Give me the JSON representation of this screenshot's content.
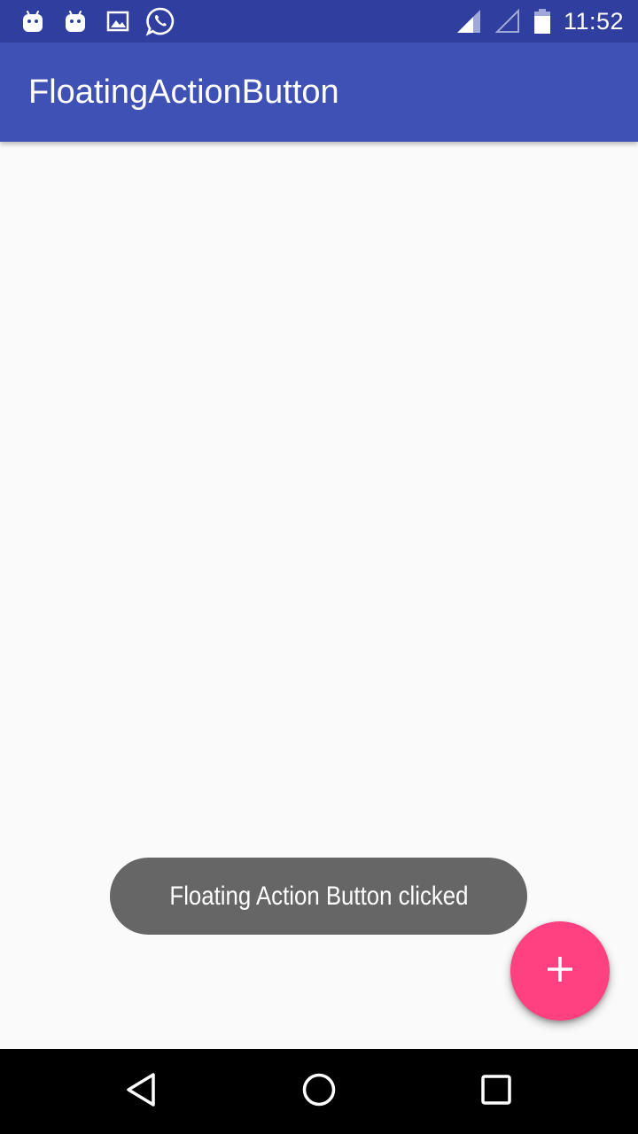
{
  "status_bar": {
    "time": "11:52",
    "left_icons": [
      "android-icon",
      "android-icon",
      "image-icon",
      "whatsapp-icon"
    ],
    "right_icons": [
      "signal-icon",
      "signal-empty-icon",
      "battery-icon"
    ]
  },
  "app_bar": {
    "title": "FloatingActionButton"
  },
  "toast": {
    "message": "Floating Action Button clicked"
  },
  "fab": {
    "icon": "plus-icon",
    "color": "#ff4081"
  },
  "nav_bar": {
    "buttons": [
      "back-icon",
      "home-icon",
      "recents-icon"
    ]
  },
  "colors": {
    "status_bar": "#303f9f",
    "app_bar": "#3f51b5",
    "accent": "#ff4081",
    "toast_bg": "#666666",
    "background": "#fafafa"
  }
}
